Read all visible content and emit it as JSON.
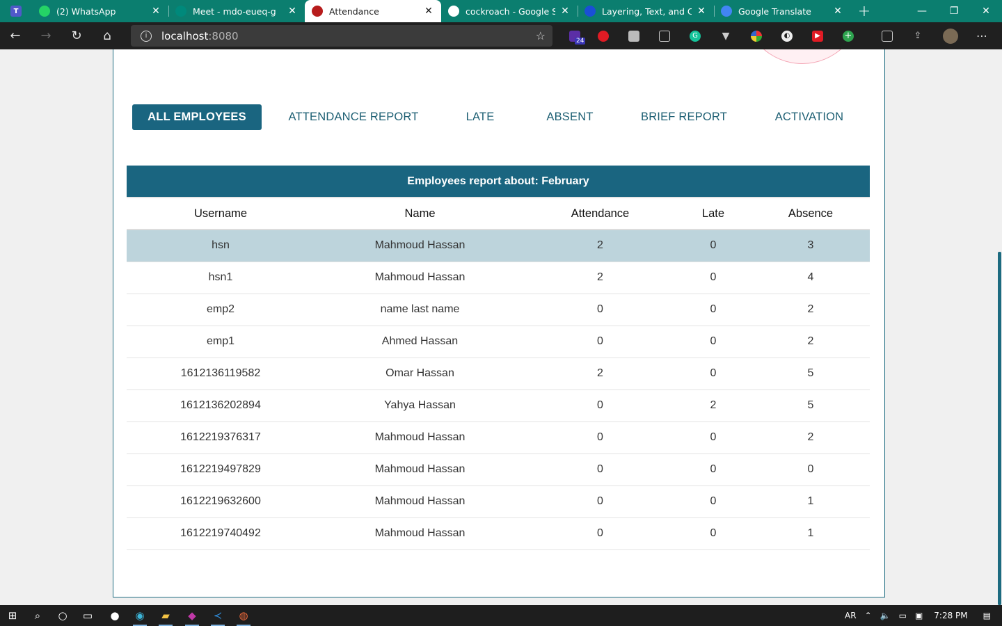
{
  "browser": {
    "tabs": [
      {
        "title": "(2) WhatsApp",
        "icon": "whatsapp-icon",
        "color": "#25d366"
      },
      {
        "title": "Meet - mdo-eueq-g",
        "icon": "google-meet-icon",
        "color": "#00897b"
      },
      {
        "title": "Attendance",
        "icon": "app-icon",
        "color": "#b71c1c",
        "active": true
      },
      {
        "title": "cockroach - Google Sear",
        "icon": "google-icon",
        "color": "#ffffff"
      },
      {
        "title": "Layering, Text, and Coun",
        "icon": "flag-icon",
        "color": "#1a4fd6"
      },
      {
        "title": "Google Translate",
        "icon": "translate-icon",
        "color": "#4285f4"
      }
    ],
    "new_tab": "+",
    "window_controls": {
      "minimize": "—",
      "restore": "❐",
      "close": "✕"
    },
    "address": {
      "host": "localhost",
      "port": ":8080"
    },
    "extension_badge": "24"
  },
  "page": {
    "nav": [
      {
        "label": "ALL EMPLOYEES",
        "active": true
      },
      {
        "label": "ATTENDANCE REPORT"
      },
      {
        "label": "LATE"
      },
      {
        "label": "ABSENT"
      },
      {
        "label": "BRIEF REPORT"
      },
      {
        "label": "ACTIVATION"
      }
    ],
    "report_title": "Employees report about: February",
    "columns": [
      "Username",
      "Name",
      "Attendance",
      "Late",
      "Absence"
    ],
    "rows": [
      [
        "hsn",
        "Mahmoud Hassan",
        "2",
        "0",
        "3"
      ],
      [
        "hsn1",
        "Mahmoud Hassan",
        "2",
        "0",
        "4"
      ],
      [
        "emp2",
        "name last name",
        "0",
        "0",
        "2"
      ],
      [
        "emp1",
        "Ahmed Hassan",
        "0",
        "0",
        "2"
      ],
      [
        "1612136119582",
        "Omar Hassan",
        "2",
        "0",
        "5"
      ],
      [
        "1612136202894",
        "Yahya Hassan",
        "0",
        "2",
        "5"
      ],
      [
        "1612219376317",
        "Mahmoud Hassan",
        "0",
        "0",
        "2"
      ],
      [
        "1612219497829",
        "Mahmoud Hassan",
        "0",
        "0",
        "0"
      ],
      [
        "1612219632600",
        "Mahmoud Hassan",
        "0",
        "0",
        "1"
      ],
      [
        "1612219740492",
        "Mahmoud Hassan",
        "0",
        "0",
        "1"
      ]
    ],
    "highlighted_row": 0,
    "colors": {
      "primary": "#1a6580",
      "highlight": "#bdd4dc"
    }
  },
  "taskbar": {
    "lang": "AR",
    "time": "7:28 PM"
  }
}
